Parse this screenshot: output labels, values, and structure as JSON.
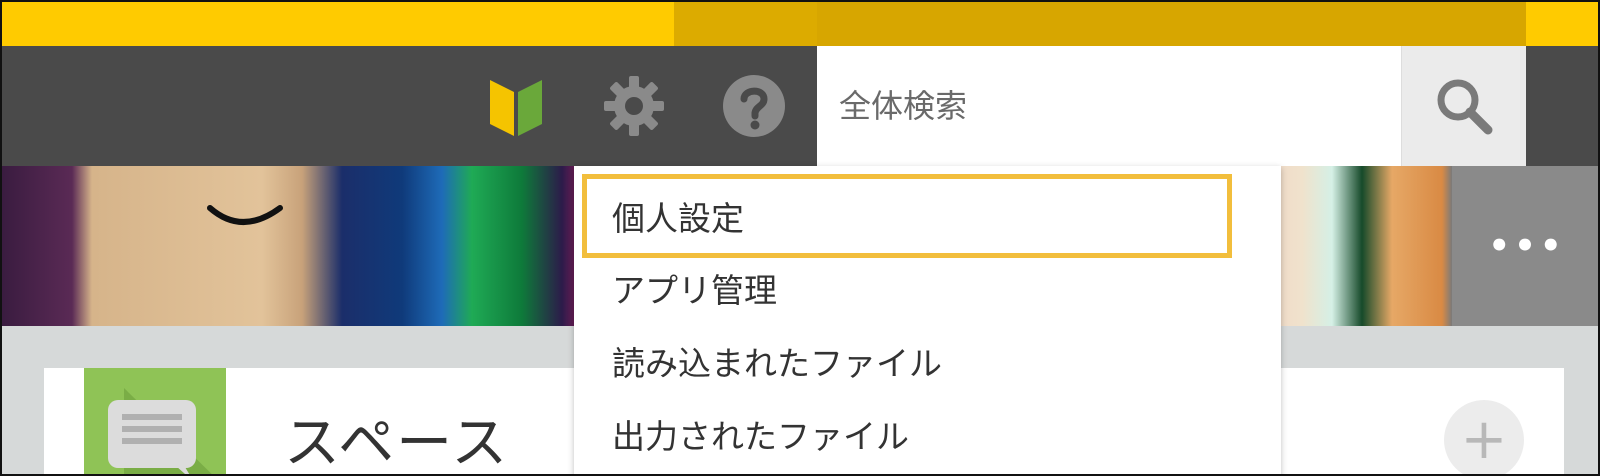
{
  "header": {
    "icons": {
      "beginner": "beginner-mark-icon",
      "settings": "gear-icon",
      "help": "question-icon"
    },
    "search": {
      "placeholder": "全体検索",
      "button_icon": "search-icon"
    }
  },
  "cover": {
    "more_label": "•••"
  },
  "dropdown": {
    "items": [
      {
        "label": "個人設定",
        "active": true
      },
      {
        "label": "アプリ管理"
      },
      {
        "label": "読み込まれたファイル"
      },
      {
        "label": "出力されたファイル"
      }
    ]
  },
  "space": {
    "title": "スペース",
    "add_label": "+"
  },
  "colors": {
    "topbar": "#ffcb00",
    "header": "#4a4a4a",
    "highlight": "#f2be3c",
    "space_green": "#8fc356"
  }
}
